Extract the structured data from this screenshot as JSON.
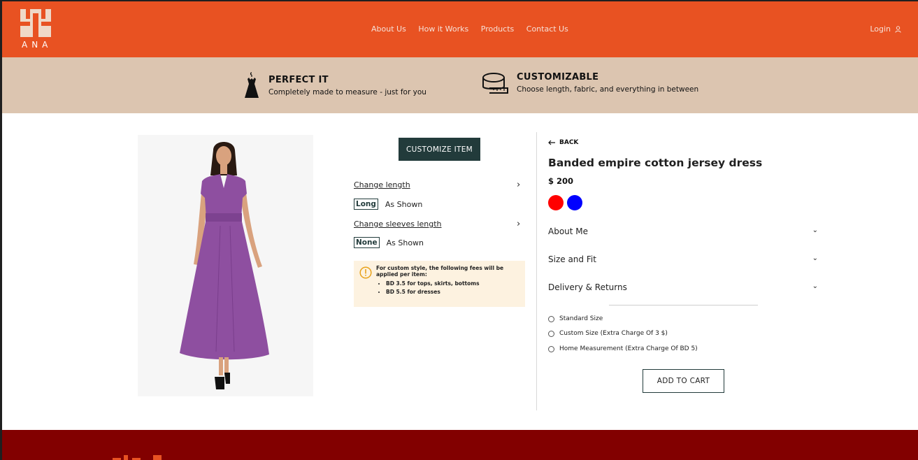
{
  "header": {
    "brand": "ANA",
    "nav": [
      "About Us",
      "How it Works",
      "Products",
      "Contact Us"
    ],
    "login_label": "Login"
  },
  "features": [
    {
      "title": "PERFECT IT",
      "subtitle": "Completely made to measure - just for you",
      "icon": "dress-hanger-icon"
    },
    {
      "title": "CUSTOMIZABLE",
      "subtitle": "Choose length, fabric, and everything in between",
      "icon": "measuring-tape-icon"
    }
  ],
  "customize": {
    "button_label": "CUSTOMIZE ITEM",
    "options": [
      {
        "label": "Change length",
        "value": "Long",
        "note": "As Shown"
      },
      {
        "label": "Change sleeves length",
        "value": "None",
        "note": "As Shown"
      }
    ],
    "notice": {
      "heading": "For custom style, the following fees will be applied per item:",
      "items": [
        "BD 3.5 for tops, skirts, bottoms",
        "BD 5.5 for dresses"
      ]
    }
  },
  "product": {
    "back_label": "BACK",
    "title": "Banded empire cotton jersey dress",
    "price": "$ 200",
    "colors": [
      "#ff0000",
      "#0000ff"
    ],
    "sections": [
      "About Me",
      "Size and Fit",
      "Delivery & Returns"
    ],
    "size_options": [
      "Standard Size",
      "Custom Size (Extra Charge Of 3 $)",
      "Home Measurement (Extra Charge Of BD 5)"
    ],
    "add_to_cart_label": "ADD TO CART"
  },
  "colors": {
    "header": "#e85222",
    "band": "#dcc5b0",
    "accent": "#223b3b",
    "footer": "#820000",
    "notice_bg": "#fdf2e0",
    "dress": "#8e4fa0"
  }
}
